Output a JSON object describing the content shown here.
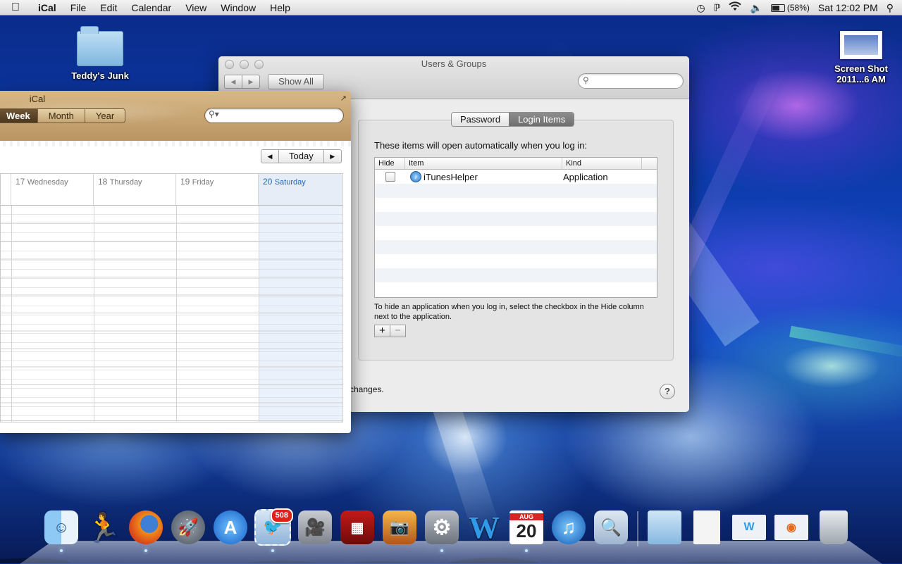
{
  "menubar": {
    "apple_icon": "apple-logo-icon",
    "app_name": "iCal",
    "menus": [
      "File",
      "Edit",
      "Calendar",
      "View",
      "Window",
      "Help"
    ],
    "battery_percent": "(58%)",
    "clock": "Sat 12:02 PM"
  },
  "desktop": {
    "folder_label": "Teddy's Junk",
    "screenshot_label_line1": "Screen Shot",
    "screenshot_label_line2": "2011...6 AM"
  },
  "users_groups": {
    "title": "Users & Groups",
    "show_all": "Show All",
    "tabs": [
      "Password",
      "Login Items"
    ],
    "active_tab": "Login Items",
    "heading": "These items will open automatically when you log in:",
    "columns": {
      "hide": "Hide",
      "item": "Item",
      "kind": "Kind"
    },
    "rows": [
      {
        "item": "iTunesHelper",
        "kind": "Application",
        "hidden": false
      }
    ],
    "hint": "To hide an application when you log in, select the checkbox in the Hide column next to the application.",
    "add_label": "+",
    "remove_label": "−",
    "changes_text": "changes.",
    "help_label": "?"
  },
  "ical": {
    "title": "iCal",
    "views": [
      "Week",
      "Month",
      "Year"
    ],
    "active_view": "Week",
    "today_label": "Today",
    "days": [
      {
        "num": "17",
        "name": "Wednesday"
      },
      {
        "num": "18",
        "name": "Thursday"
      },
      {
        "num": "19",
        "name": "Friday"
      },
      {
        "num": "20",
        "name": "Saturday"
      }
    ]
  },
  "dock": {
    "mail_badge": "508",
    "ical_date_month": "AUG",
    "ical_date_day": "20"
  }
}
